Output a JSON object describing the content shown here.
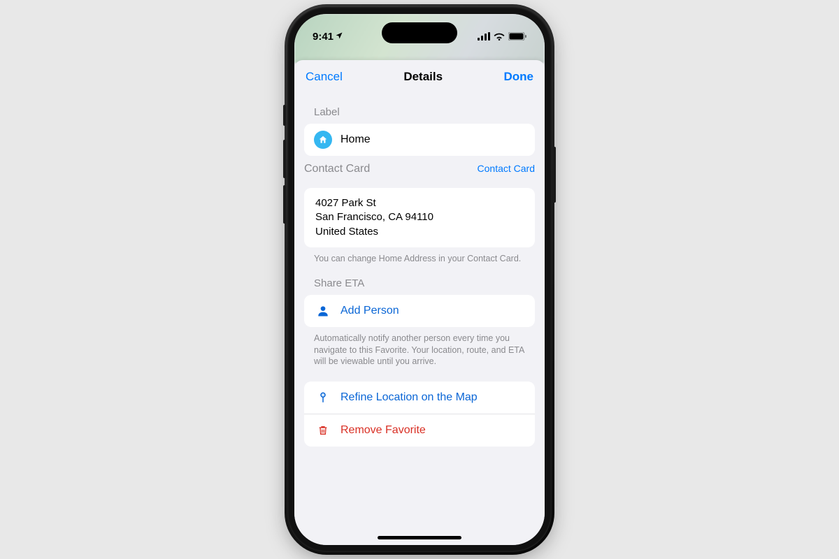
{
  "status": {
    "time": "9:41"
  },
  "nav": {
    "cancel": "Cancel",
    "title": "Details",
    "done": "Done"
  },
  "label_section": {
    "header": "Label",
    "value": "Home"
  },
  "contact_section": {
    "header": "Contact Card",
    "link": "Contact Card",
    "address_line1": "4027 Park St",
    "address_line2": "San Francisco, CA 94110",
    "address_line3": "United States",
    "note": "You can change Home Address in your Contact Card."
  },
  "share_section": {
    "header": "Share ETA",
    "add_person": "Add Person",
    "note": "Automatically notify another person every time you navigate to this Favorite. Your location, route, and ETA will be viewable until you arrive."
  },
  "actions": {
    "refine": "Refine Location on the Map",
    "remove": "Remove Favorite"
  }
}
